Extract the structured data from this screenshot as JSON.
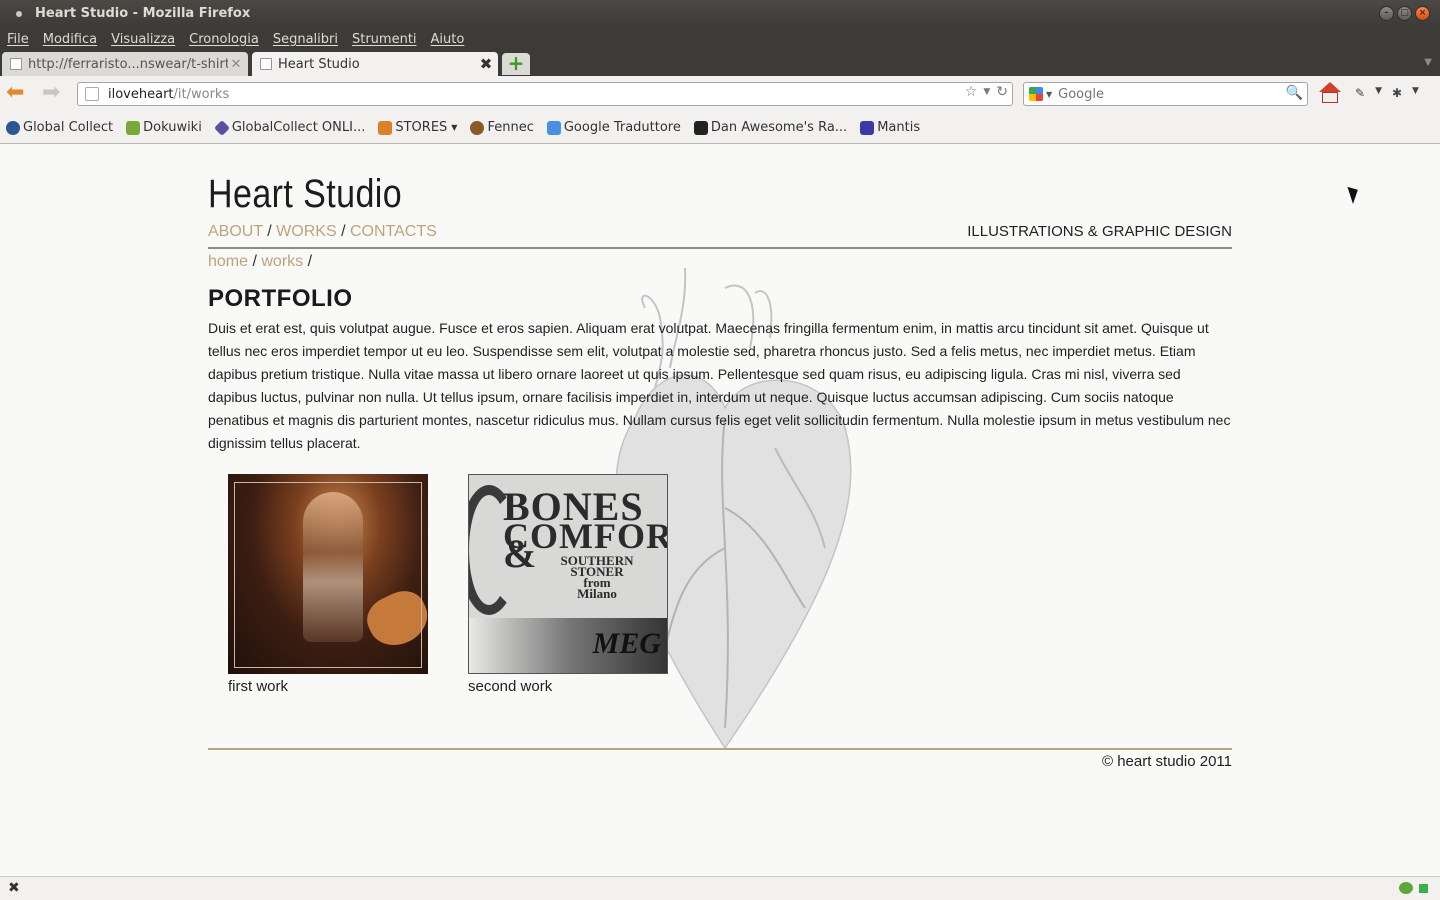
{
  "window": {
    "title": "Heart Studio - Mozilla Firefox"
  },
  "menu": [
    "File",
    "Modifica",
    "Visualizza",
    "Cronologia",
    "Segnalibri",
    "Strumenti",
    "Aiuto"
  ],
  "tabs": [
    {
      "label": "http://ferraristo...nswear/t-shirts/",
      "active": false
    },
    {
      "label": "Heart Studio",
      "active": true
    }
  ],
  "url": {
    "host": "iloveheart",
    "path": "/it/works"
  },
  "search": {
    "placeholder": "Google"
  },
  "bookmarks": [
    {
      "label": "Global Collect",
      "icon": "globe-icon",
      "color": "#2b5797"
    },
    {
      "label": "Dokuwiki",
      "icon": "dokuwiki-icon",
      "color": "#7aa83a"
    },
    {
      "label": "GlobalCollect ONLI...",
      "icon": "diamond-icon",
      "color": "#5a4fa3"
    },
    {
      "label": "STORES",
      "icon": "folder-icon",
      "color": "#d9822b"
    },
    {
      "label": "Fennec",
      "icon": "fennec-icon",
      "color": "#8a5a2b"
    },
    {
      "label": "Google Traduttore",
      "icon": "translate-icon",
      "color": "#4a8fe0"
    },
    {
      "label": "Dan Awesome's Ra...",
      "icon": "dark-icon",
      "color": "#222222"
    },
    {
      "label": "Mantis",
      "icon": "mantis-icon",
      "color": "#3b3ba8"
    }
  ],
  "site": {
    "title": "Heart Studio",
    "nav": [
      "ABOUT",
      "WORKS",
      "CONTACTS"
    ],
    "nav_sep": " / ",
    "tagline": "ILLUSTRATIONS & GRAPHIC DESIGN",
    "breadcrumb": [
      "home",
      "works"
    ],
    "heading": "PORTFOLIO",
    "intro": "Duis et erat est, quis volutpat augue. Fusce et eros sapien. Aliquam erat volutpat. Maecenas fringilla fermentum enim, in mattis arcu tincidunt sit amet. Quisque ut tellus nec eros imperdiet tempor ut eu leo. Suspendisse sem elit, volutpat a molestie sed, pharetra rhoncus justo. Sed a felis metus, nec imperdiet metus. Etiam dapibus pretium tristique. Nulla vitae massa ut libero ornare laoreet ut quis ipsum. Pellentesque sed quam risus, eu adipiscing ligula. Cras mi nisl, viverra sed dapibus luctus, pulvinar non nulla. Ut tellus ipsum, ornare facilisis imperdiet in, interdum ut neque. Quisque luctus accumsan adipiscing. Cum sociis natoque penatibus et magnis dis parturient montes, nascetur ridiculus mus. Nullam cursus felis eget velit sollicitudin fermentum. Nulla molestie ipsum in metus vestibulum nec dignissim tellus placerat.",
    "works": [
      {
        "caption": "first work"
      },
      {
        "caption": "second work",
        "art_lines": [
          "BONES &",
          "COMFORT",
          "SOUTHERN",
          "STONER",
          "from",
          "Milano",
          "MEG"
        ]
      }
    ],
    "copyright": "© heart studio 2011",
    "accent_color": "#bfa27c"
  }
}
